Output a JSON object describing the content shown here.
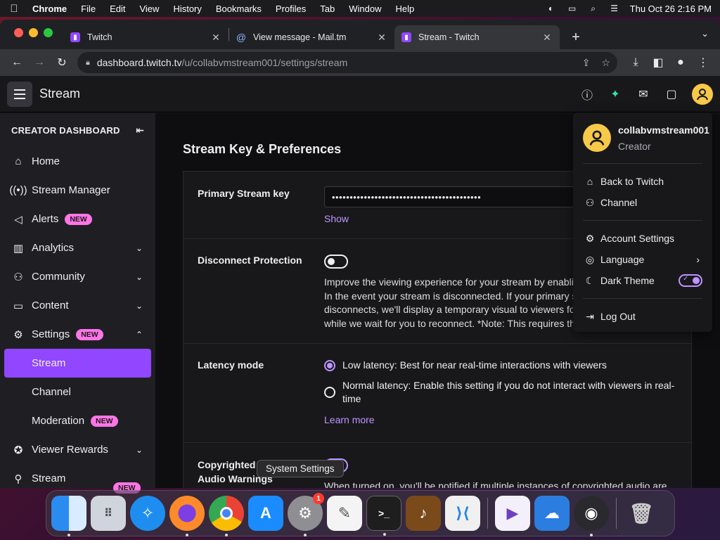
{
  "menubar": {
    "app": "Chrome",
    "items": [
      "File",
      "Edit",
      "View",
      "History",
      "Bookmarks",
      "Profiles",
      "Tab",
      "Window",
      "Help"
    ],
    "clock": "Thu Oct 26  2:16 PM"
  },
  "tabs": [
    {
      "label": "Twitch",
      "icon": "twitch-icon"
    },
    {
      "label": "View message - Mail.tm",
      "icon": "mail-icon"
    },
    {
      "label": "Stream - Twitch",
      "icon": "twitch-icon"
    }
  ],
  "address": {
    "host": "dashboard.twitch.tv",
    "path": "/u/collabvmstream001/settings/stream"
  },
  "topbar": {
    "title": "Stream"
  },
  "sidebar": {
    "header": "CREATOR DASHBOARD",
    "items": {
      "home": "Home",
      "stream_manager": "Stream Manager",
      "alerts": "Alerts",
      "analytics": "Analytics",
      "community": "Community",
      "content": "Content",
      "settings": "Settings",
      "stream": "Stream",
      "channel": "Channel",
      "moderation": "Moderation",
      "viewer_rewards": "Viewer Rewards",
      "stream_last": "Stream"
    },
    "badge_new": "NEW"
  },
  "main": {
    "section_title": "Stream Key & Preferences",
    "primary_key_label": "Primary Stream key",
    "primary_key_value": "••••••••••••••••••••••••••••••••••••••••••",
    "show_link": "Show",
    "disconnect_label": "Disconnect Protection",
    "disconnect_desc": "Improve the viewing experience for your stream by enabling this setting. In the event your stream is disconnected. If your primary stream disconnects, we'll display a temporary visual to viewers for 90 seconds while we wait for you to reconnect. *Note: This requires the use of a major encoder.",
    "latency_label": "Latency mode",
    "latency_low": "Low latency: Best for near real-time interactions with viewers",
    "latency_normal": "Normal latency: Enable this setting if you do not interact with viewers in real-time",
    "learn_more": "Learn more",
    "copyright_label": "Copyrighted Audio Warnings",
    "copyright_desc": "When turned on, you'll be notified if multiple instances of copyrighted audio are"
  },
  "dropdown": {
    "username": "collabvmstream001",
    "role": "Creator",
    "back": "Back to Twitch",
    "channel": "Channel",
    "account_settings": "Account Settings",
    "language": "Language",
    "dark_theme": "Dark Theme",
    "log_out": "Log Out"
  },
  "tooltip": "System Settings",
  "dock": {
    "notification_count": "1"
  },
  "colors": {
    "twitch_purple": "#9146ff",
    "accent_light": "#bf94ff",
    "badge_pink": "#ff75e6",
    "avatar_yellow": "#f7c948"
  }
}
